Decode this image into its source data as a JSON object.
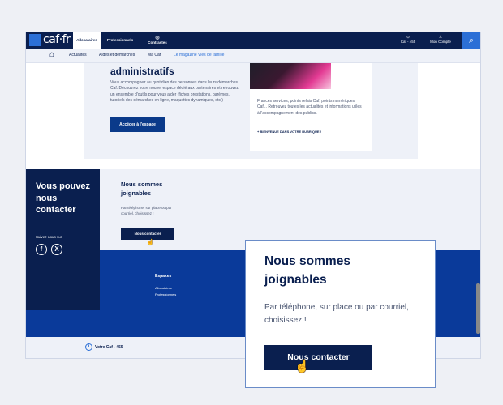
{
  "header": {
    "logo_text": "caf·fr",
    "tabs": [
      {
        "label": "Allocataires"
      },
      {
        "label": "Professionnels"
      },
      {
        "label": "Contrastes"
      }
    ],
    "votre_caf": "Caf - 455",
    "mon_compte": "Mon Compte"
  },
  "nav": {
    "items": [
      {
        "label": "Actualités"
      },
      {
        "label": "Aides et démarches"
      },
      {
        "label": "Ma Caf"
      },
      {
        "label": "Le magazine Vies de famille"
      }
    ]
  },
  "content": {
    "title": "administratifs",
    "text": "Vous accompagnez au quotidien des personnes dans leurs démarches Caf. Découvrez votre nouvel espace dédié aux partenaires et retrouvez un ensemble d'outils pour vous aider (fiches prestations, barèmes, tutoriels des démarches en ligne, maquettes dynamiques, etc.)",
    "access_button": "Accéder à l'espace",
    "side_text": "Frances services, points relais Caf, points numériques Caf... Retrouvez toutes les actualités et informations utiles à l'accompagnement des publics.",
    "side_link": "+ BIENVENUE DANS VOTRE RUBRIQUE !"
  },
  "contact": {
    "big_title": "Vous pouvez nous contacter",
    "follow_label": "Suivez-nous sur",
    "title": "Nous sommes joignables",
    "text": "Par téléphone, sur place ou par courriel, choisissez !",
    "button": "Nous contacter"
  },
  "footer": {
    "title": "Espaces",
    "links": [
      {
        "label": "Allocataires"
      },
      {
        "label": "Professionnels"
      }
    ],
    "bottom_label": "Votre Caf - 455"
  },
  "zoom": {
    "title": "Nous sommes joignables",
    "text": "Par téléphone, sur place ou par courriel, choisissez !",
    "button": "Nous contacter"
  },
  "colors": {
    "navy": "#0a1f4f",
    "accent_blue": "#2b6fd6",
    "footer_blue": "#0a3a9a",
    "light_bg": "#eef1f8"
  }
}
